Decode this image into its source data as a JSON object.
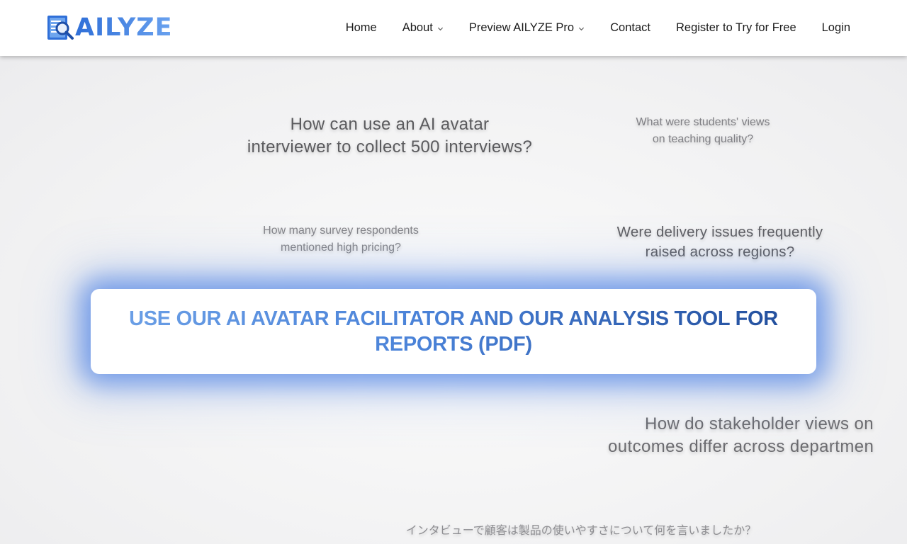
{
  "header": {
    "logo_text": "AILYZE",
    "nav": [
      {
        "label": "Home",
        "dropdown": false
      },
      {
        "label": "About",
        "dropdown": true
      },
      {
        "label": "Preview AILYZE Pro",
        "dropdown": true
      },
      {
        "label": "Contact",
        "dropdown": false
      },
      {
        "label": "Register to Try for Free",
        "dropdown": false
      },
      {
        "label": "Login",
        "dropdown": false
      }
    ]
  },
  "questions": {
    "q1_line1": "How can use an AI avatar",
    "q1_line2": "interviewer to collect 500 interviews?",
    "q2_line1": "What were students' views",
    "q2_line2": "on teaching quality?",
    "q3_line1": "How many survey respondents",
    "q3_line2": "mentioned high pricing?",
    "q4_line1": "Were delivery issues frequently",
    "q4_line2": "raised across regions?",
    "q5_line1": "How do stakeholder views on",
    "q5_line2": "outcomes differ across departmen",
    "q6_line1": "インタビューで顧客は製品の使いやすさについて何を言いましたか？"
  },
  "cta": {
    "text": "USE OUR AI AVATAR FACILITATOR AND OUR ANALYSIS TOOL FOR REPORTS (PDF)"
  },
  "colors": {
    "brand_blue": "#3b77d9",
    "glow_blue": "#3e76e2",
    "cta_dark_blue": "#234f9d"
  },
  "icons": {
    "logo": "document-magnifier-icon",
    "dropdown": "chevron-down-icon"
  }
}
